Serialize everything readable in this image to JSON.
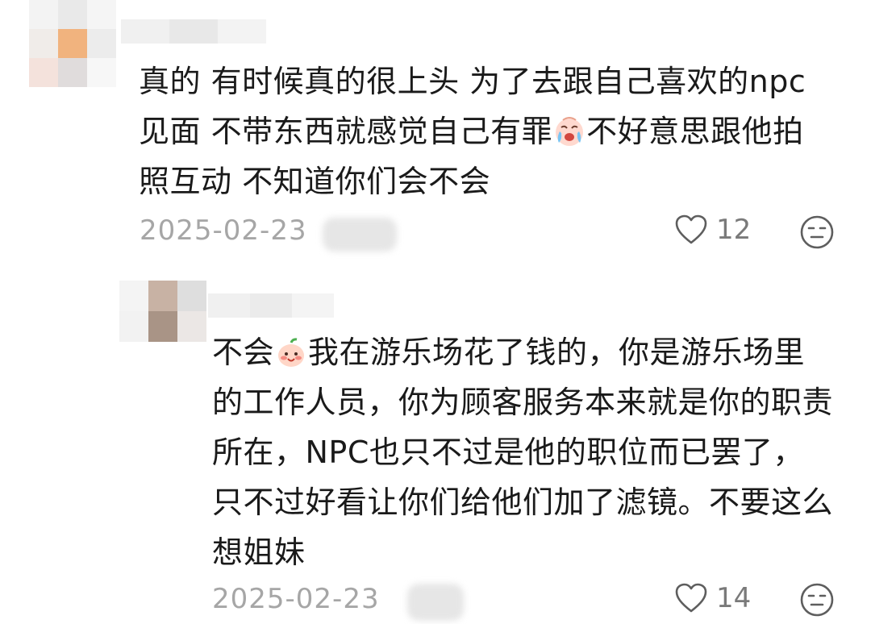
{
  "comments": [
    {
      "text_lines": [
        "真的 有时候真的很上头 为了去跟自己喜欢的npc",
        [
          "见面 不带东西就感觉自己有罪",
          "不好意思跟他拍"
        ],
        "照互动 不知道你们会不会"
      ],
      "emoji": "crying-face-emoji",
      "date": "2025-02-23",
      "likes": "12",
      "reaction_icon": "neutral-face-icon"
    },
    {
      "text_lines": [
        [
          "不会",
          "我在游乐场花了钱的，你是游乐场里"
        ],
        "的工作人员，你为顾客服务本来就是你的职责",
        "所在，NPC也只不过是他的职位而已罢了，",
        "只不过好看让你们给他们加了滤镜。不要这么",
        "想姐妹"
      ],
      "emoji": "smiling-blush-emoji",
      "date": "2025-02-23",
      "likes": "14",
      "reaction_icon": "neutral-face-icon"
    }
  ],
  "comment1": {
    "line1": "真的 有时候真的很上头 为了去跟自己喜欢的npc",
    "line2a": "见面 不带东西就感觉自己有罪",
    "line2b": "不好意思跟他拍",
    "line3": "照互动 不知道你们会不会",
    "date": "2025-02-23",
    "likes": "12"
  },
  "comment2": {
    "line1a": "不会",
    "line1b": "我在游乐场花了钱的，你是游乐场里",
    "line2": "的工作人员，你为顾客服务本来就是你的职责",
    "line3": "所在，NPC也只不过是他的职位而已罢了，",
    "line4": "只不过好看让你们给他们加了滤镜。不要这么",
    "line5": "想姐妹",
    "date": "2025-02-23",
    "likes": "14"
  },
  "colors": {
    "text": "#1a1a1a",
    "meta": "#a6a6a6",
    "icon": "#666666"
  }
}
